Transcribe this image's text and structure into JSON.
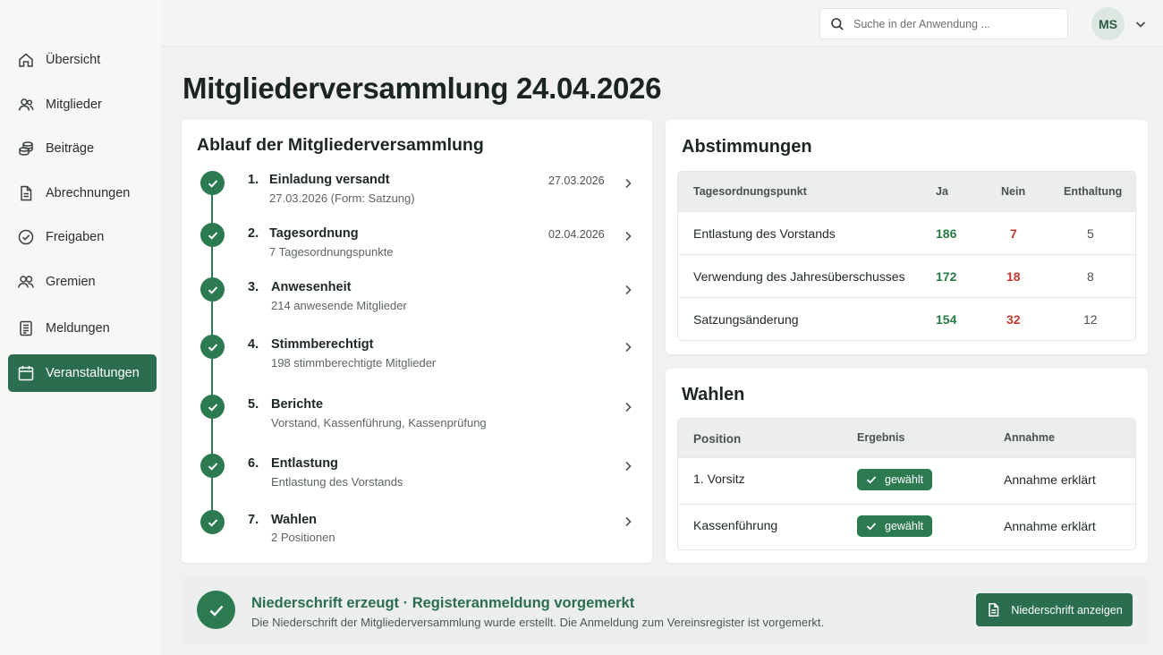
{
  "sidebar": {
    "items": [
      {
        "label": "Übersicht",
        "icon": "home-icon"
      },
      {
        "label": "Mitglieder",
        "icon": "users-icon"
      },
      {
        "label": "Beiträge",
        "icon": "coins-icon"
      },
      {
        "label": "Abrechnungen",
        "icon": "document-icon"
      },
      {
        "label": "Freigaben",
        "icon": "check-circle-icon"
      },
      {
        "label": "Gremien",
        "icon": "group-icon"
      },
      {
        "label": "Meldungen",
        "icon": "report-icon"
      },
      {
        "label": "Veranstaltungen",
        "icon": "calendar-icon",
        "active": true
      }
    ]
  },
  "topbar": {
    "search_placeholder": "Suche in der Anwendung ...",
    "avatar_initials": "MS"
  },
  "page": {
    "title": "Mitgliederversammlung 24.04.2026"
  },
  "steps": {
    "title": "Ablauf der Mitgliederversammlung",
    "items": [
      {
        "num": "1.",
        "title": "Einladung versandt",
        "sub": "27.03.2026  (Form: Satzung)",
        "date": "27.03.2026"
      },
      {
        "num": "2.",
        "title": "Tagesordnung",
        "sub": "7 Tagesordnungspunkte",
        "date": "02.04.2026"
      },
      {
        "num": "3.",
        "title": "Anwesenheit",
        "sub": "214 anwesende Mitglieder",
        "date": ""
      },
      {
        "num": "4.",
        "title": "Stimmberechtigt",
        "sub": "198 stimmberechtigte Mitglieder",
        "date": ""
      },
      {
        "num": "5.",
        "title": "Berichte",
        "sub": "Vorstand, Kassenführung, Kassenprüfung",
        "date": ""
      },
      {
        "num": "6.",
        "title": "Entlastung",
        "sub": "Entlastung des Vorstands",
        "date": ""
      },
      {
        "num": "7.",
        "title": "Wahlen",
        "sub": "2 Positionen",
        "date": ""
      }
    ]
  },
  "votes": {
    "title": "Abstimmungen",
    "headers": [
      "Tagesordnungspunkt",
      "Ja",
      "Nein",
      "Enthaltung"
    ],
    "rows": [
      {
        "item": "Entlastung des Vorstands",
        "ja": "186",
        "nein": "7",
        "enthaltung": "5"
      },
      {
        "item": "Verwendung des Jahresüberschusses",
        "ja": "172",
        "nein": "18",
        "enthaltung": "8"
      },
      {
        "item": "Satzungsänderung",
        "ja": "154",
        "nein": "32",
        "enthaltung": "12"
      }
    ]
  },
  "elections": {
    "title": "Wahlen",
    "headers": [
      "Position",
      "Ergebnis",
      "Annahme"
    ],
    "rows": [
      {
        "position": "1. Vorsitz",
        "result": "gewählt",
        "acceptance": "Annahme erklärt"
      },
      {
        "position": "Kassenführung",
        "result": "gewählt",
        "acceptance": "Annahme erklärt"
      }
    ]
  },
  "banner": {
    "title": "Niederschrift erzeugt  ·  Registeranmeldung vorgemerkt",
    "subtitle": "Die Niederschrift der Mitgliederversammlung wurde erstellt.  Die Anmeldung zum Vereinsregister ist vorgemerkt.",
    "button_label": "Niederschrift anzeigen"
  },
  "colors": {
    "accent": "#2b6e4f",
    "success": "#267a45",
    "danger": "#c23a2f"
  }
}
